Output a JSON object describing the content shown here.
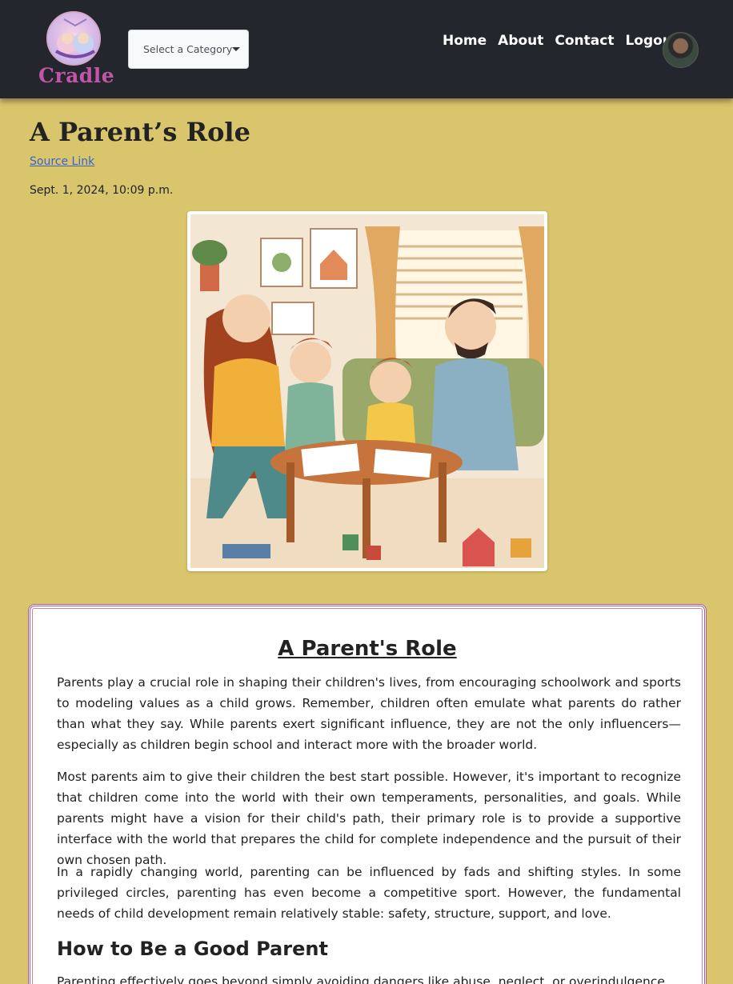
{
  "header": {
    "logo_text": "Cradle",
    "category_select": {
      "selected": "Select a Category"
    },
    "nav": [
      "Home",
      "About",
      "Contact",
      "Logout"
    ]
  },
  "post": {
    "title": "A Parent’s Role",
    "source_link": "Source Link",
    "date": "Sept. 1, 2024, 10:09 p.m."
  },
  "article": {
    "title": "A Parent's Role",
    "paragraphs": [
      "Parents play a crucial role in shaping their children's lives, from encouraging schoolwork and sports to modeling values as a child grows. Remember, children often emulate what parents do rather than what they say. While parents exert significant influence, they are not the only influencers—especially as children begin school and interact more with the broader world.",
      "Most parents aim to give their children the best start possible. However, it's important to recognize that children come into the world with their own temperaments, personalities, and goals. While parents might have a vision for their child's path, their primary role is to provide a supportive interface with the world that prepares the child for complete independence and the pursuit of their own chosen path.",
      "In a rapidly changing world, parenting can be influenced by fads and shifting styles. In some privileged circles, parenting has even become a competitive sport. However, the fundamental needs of child development remain relatively stable: safety, structure, support, and love.",
      "Parenting effectively goes beyond simply avoiding dangers like abuse, neglect, or overindulgence."
    ],
    "subheading": "How to Be a Good Parent"
  },
  "colors": {
    "page_bg": "#d8c56c",
    "navbar_bg": "#23262c",
    "card_border": "#b05c8f",
    "link": "#3a63c9"
  }
}
